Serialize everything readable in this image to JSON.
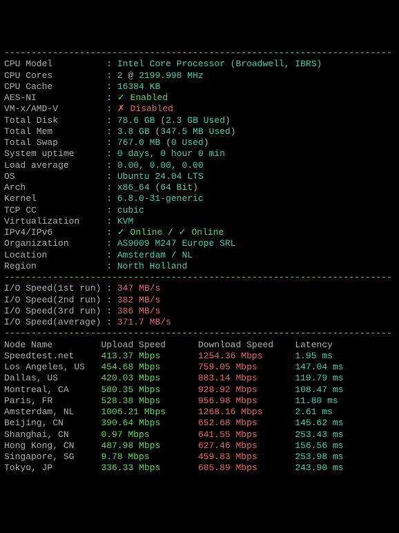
{
  "labels": {
    "cpu_model": "CPU Model",
    "cpu_cores": "CPU Cores",
    "cpu_cache": "CPU Cache",
    "aes_ni": "AES-NI",
    "vm_x": "VM-x/AMD-V",
    "total_disk": "Total Disk",
    "total_mem": "Total Mem",
    "total_swap": "Total Swap",
    "uptime": "System uptime",
    "load": "Load average",
    "os": "OS",
    "arch": "Arch",
    "kernel": "Kernel",
    "tcp_cc": "TCP CC",
    "virt": "Virtualization",
    "ipv": "IPv4/IPv6",
    "org": "Organization",
    "loc": "Location",
    "region": "Region",
    "io1": "I/O Speed(1st run)",
    "io2": "I/O Speed(2nd run)",
    "io3": "I/O Speed(3rd run)",
    "ioavg": "I/O Speed(average)",
    "node_name": "Node Name",
    "upload": "Upload Speed",
    "download": "Download Speed",
    "latency": "Latency"
  },
  "sys": {
    "cpu_model": "Intel Core Processor (Broadwell, IBRS)",
    "cpu_cores_n": "2",
    "cpu_cores_at": " @ ",
    "cpu_cores_freq": "2199.998 MHz",
    "cpu_cache": "16384 KB",
    "aes_ni_check": "✓ ",
    "aes_ni_txt": "Enabled",
    "vm_x_x": "✗ ",
    "vm_x_txt": "Disabled",
    "total_disk_val": "78.6 GB",
    "total_disk_used": "2.3 GB Used",
    "total_mem_val": "3.8 GB",
    "total_mem_used": "347.5 MB Used",
    "total_swap_val": "767.0 MB",
    "total_swap_used": "0 Used",
    "uptime": "0 days, 0 hour 0 min",
    "load": "0.00, 0.00, 0.00",
    "os": "Ubuntu 24.04 LTS",
    "arch_val": "x86_64",
    "arch_bits": "64 Bit",
    "kernel": "6.8.0-31-generic",
    "tcp_cc": "cubic",
    "virt": "KVM",
    "online_chk1": "✓ ",
    "online_txt1": "Online",
    "online_sep": " / ",
    "online_chk2": "✓ ",
    "online_txt2": "Online",
    "org": "AS9009 M247 Europe SRL",
    "loc": "Amsterdam / NL",
    "region": "North Holland"
  },
  "io": {
    "r1": "347 MB/s",
    "r2": "382 MB/s",
    "r3": "386 MB/s",
    "avg": "371.7 MB/s"
  },
  "speedtest": [
    {
      "node": "Speedtest.net",
      "up": "413.37 Mbps",
      "down": "1254.36 Mbps",
      "lat": "1.95 ms"
    },
    {
      "node": "Los Angeles, US",
      "up": "454.68 Mbps",
      "down": "759.05 Mbps",
      "lat": "147.04 ms"
    },
    {
      "node": "Dallas, US",
      "up": "420.03 Mbps",
      "down": "883.14 Mbps",
      "lat": "119.79 ms"
    },
    {
      "node": "Montreal, CA",
      "up": "580.35 Mbps",
      "down": "928.92 Mbps",
      "lat": "108.47 ms"
    },
    {
      "node": "Paris, FR",
      "up": "528.38 Mbps",
      "down": "956.98 Mbps",
      "lat": "11.80 ms"
    },
    {
      "node": "Amsterdam, NL",
      "up": "1006.21 Mbps",
      "down": "1268.16 Mbps",
      "lat": "2.61 ms"
    },
    {
      "node": "Beijing, CN",
      "up": "390.64 Mbps",
      "down": "652.68 Mbps",
      "lat": "145.62 ms"
    },
    {
      "node": "Shanghai, CN",
      "up": "0.97 Mbps",
      "down": "641.55 Mbps",
      "lat": "253.43 ms"
    },
    {
      "node": "Hong Kong, CN",
      "up": "487.98 Mbps",
      "down": "627.46 Mbps",
      "lat": "156.56 ms"
    },
    {
      "node": "Singapore, SG",
      "up": "9.78 Mbps",
      "down": "459.83 Mbps",
      "lat": "253.98 ms"
    },
    {
      "node": "Tokyo, JP",
      "up": "336.33 Mbps",
      "down": "685.89 Mbps",
      "lat": "243.90 ms"
    }
  ]
}
